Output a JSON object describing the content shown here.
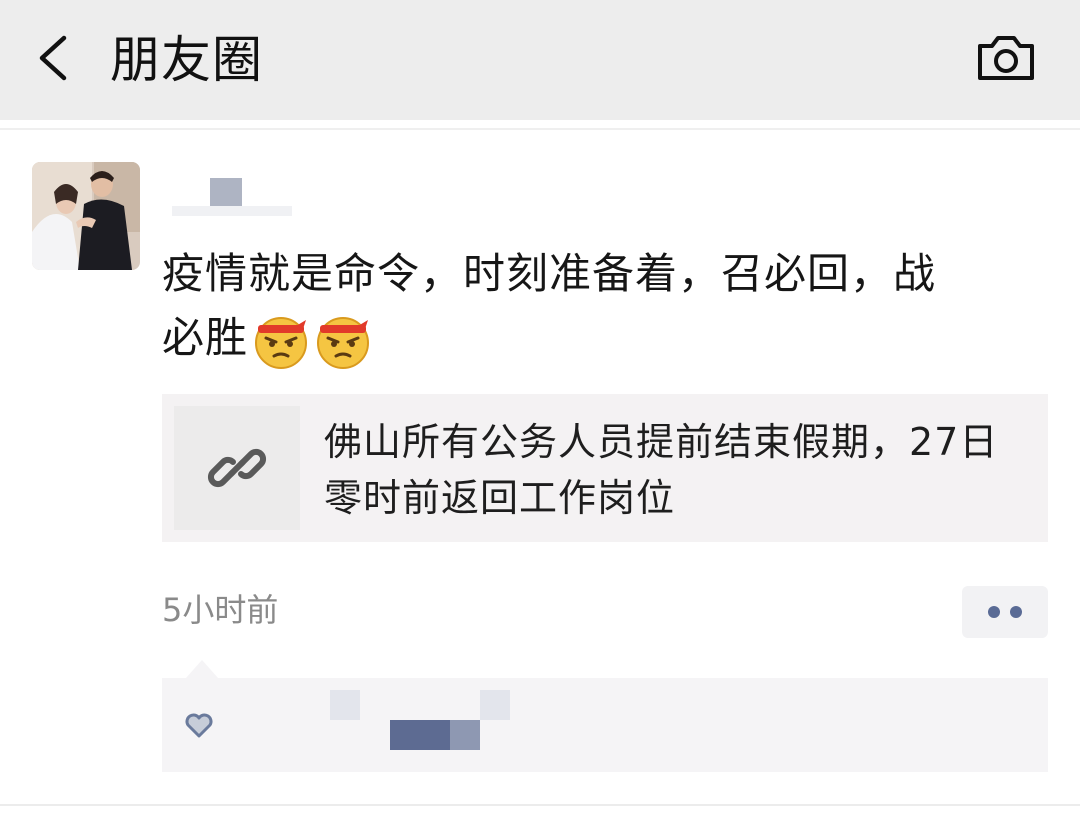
{
  "header": {
    "title": "朋友圈",
    "back_icon": "chevron-left-icon",
    "camera_icon": "camera-icon"
  },
  "post": {
    "author_name": "",
    "text": "疫情就是命令，时刻准备着，召必回，战必胜",
    "emojis": [
      "determined-face-emoji",
      "determined-face-emoji"
    ],
    "link": {
      "icon": "link-icon",
      "title": "佛山所有公务人员提前结束假期，27日零时前返回工作岗位"
    },
    "timestamp": "5小时前",
    "more_icon": "more-dots-icon",
    "likes_icon": "heart-icon"
  },
  "colors": {
    "topbar_bg": "#ededed",
    "card_bg": "#f4f2f3",
    "name_blue": "#5a6b95",
    "timestamp_gray": "#8a8a8a"
  }
}
